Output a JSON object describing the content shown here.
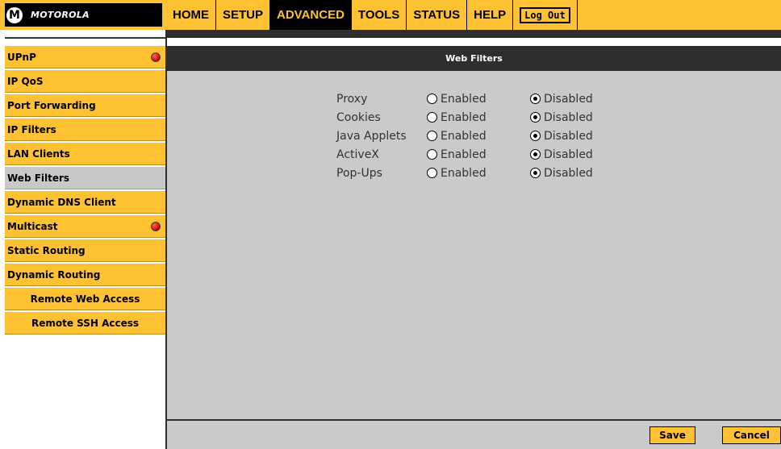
{
  "brand": {
    "name": "MOTOROLA",
    "logo_glyph": "M"
  },
  "nav": {
    "items": [
      {
        "label": "HOME",
        "active": false
      },
      {
        "label": "SETUP",
        "active": false
      },
      {
        "label": "ADVANCED",
        "active": true
      },
      {
        "label": "TOOLS",
        "active": false
      },
      {
        "label": "STATUS",
        "active": false
      },
      {
        "label": "HELP",
        "active": false
      }
    ],
    "logout_label": "Log Out"
  },
  "sidebar": {
    "items": [
      {
        "label": "UPnP",
        "alert": true
      },
      {
        "label": "IP QoS",
        "alert": false
      },
      {
        "label": "Port Forwarding",
        "alert": false
      },
      {
        "label": "IP Filters",
        "alert": false
      },
      {
        "label": "LAN Clients",
        "alert": false
      },
      {
        "label": "Web Filters",
        "alert": false,
        "active": true
      },
      {
        "label": "Dynamic DNS Client",
        "alert": false
      },
      {
        "label": "Multicast",
        "alert": true
      },
      {
        "label": "Static Routing",
        "alert": false
      },
      {
        "label": "Dynamic Routing",
        "alert": false
      },
      {
        "label": "Remote Web Access",
        "alert": false
      },
      {
        "label": "Remote SSH Access",
        "alert": false
      }
    ]
  },
  "main": {
    "title": "Web Filters",
    "enabled_label": "Enabled",
    "disabled_label": "Disabled",
    "filters": [
      {
        "label": "Proxy",
        "value": "Disabled"
      },
      {
        "label": "Cookies",
        "value": "Disabled"
      },
      {
        "label": "Java Applets",
        "value": "Disabled"
      },
      {
        "label": "ActiveX",
        "value": "Disabled"
      },
      {
        "label": "Pop-Ups",
        "value": "Disabled"
      }
    ],
    "save_label": "Save",
    "cancel_label": "Cancel"
  },
  "colors": {
    "accent": "#fec132",
    "dark": "#2e2e2e",
    "panel": "#cacaca",
    "alert": "#d11000"
  }
}
